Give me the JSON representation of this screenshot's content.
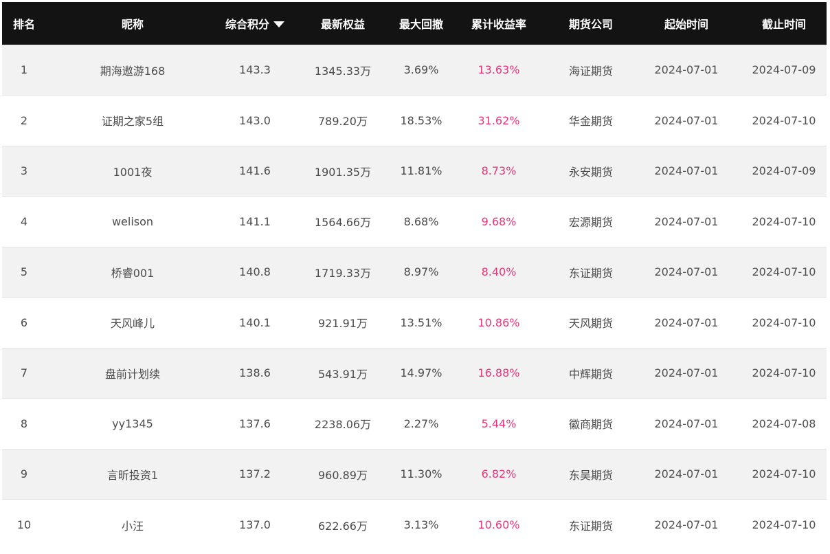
{
  "header": {
    "rank": "排名",
    "nickname": "昵称",
    "score": "综合积分",
    "equity": "最新权益",
    "drawdown": "最大回撤",
    "return": "累计收益率",
    "company": "期货公司",
    "start": "起始时间",
    "end": "截止时间"
  },
  "colors": {
    "header_bg": "#131313",
    "return_color": "#e8357a",
    "row_alt": "#f2f2f2"
  },
  "rows": [
    {
      "rank": "1",
      "nickname": "期海遨游168",
      "score": "143.3",
      "equity": "1345.33万",
      "drawdown": "3.69%",
      "return": "13.63%",
      "company": "海证期货",
      "start": "2024-07-01",
      "end": "2024-07-09"
    },
    {
      "rank": "2",
      "nickname": "证期之家5组",
      "score": "143.0",
      "equity": "789.20万",
      "drawdown": "18.53%",
      "return": "31.62%",
      "company": "华金期货",
      "start": "2024-07-01",
      "end": "2024-07-10"
    },
    {
      "rank": "3",
      "nickname": "1001夜",
      "score": "141.6",
      "equity": "1901.35万",
      "drawdown": "11.81%",
      "return": "8.73%",
      "company": "永安期货",
      "start": "2024-07-01",
      "end": "2024-07-09"
    },
    {
      "rank": "4",
      "nickname": "welison",
      "score": "141.1",
      "equity": "1564.66万",
      "drawdown": "8.68%",
      "return": "9.68%",
      "company": "宏源期货",
      "start": "2024-07-01",
      "end": "2024-07-10"
    },
    {
      "rank": "5",
      "nickname": "桥睿001",
      "score": "140.8",
      "equity": "1719.33万",
      "drawdown": "8.97%",
      "return": "8.40%",
      "company": "东证期货",
      "start": "2024-07-01",
      "end": "2024-07-10"
    },
    {
      "rank": "6",
      "nickname": "天风峰儿",
      "score": "140.1",
      "equity": "921.91万",
      "drawdown": "13.51%",
      "return": "10.86%",
      "company": "天风期货",
      "start": "2024-07-01",
      "end": "2024-07-10"
    },
    {
      "rank": "7",
      "nickname": "盘前计划续",
      "score": "138.6",
      "equity": "543.91万",
      "drawdown": "14.97%",
      "return": "16.88%",
      "company": "中辉期货",
      "start": "2024-07-01",
      "end": "2024-07-10"
    },
    {
      "rank": "8",
      "nickname": "yy1345",
      "score": "137.6",
      "equity": "2238.06万",
      "drawdown": "2.27%",
      "return": "5.44%",
      "company": "徽商期货",
      "start": "2024-07-01",
      "end": "2024-07-08"
    },
    {
      "rank": "9",
      "nickname": "言昕投资1",
      "score": "137.2",
      "equity": "960.89万",
      "drawdown": "11.30%",
      "return": "6.82%",
      "company": "东吴期货",
      "start": "2024-07-01",
      "end": "2024-07-10"
    },
    {
      "rank": "10",
      "nickname": "小汪",
      "score": "137.0",
      "equity": "622.66万",
      "drawdown": "3.13%",
      "return": "10.60%",
      "company": "东证期货",
      "start": "2024-07-01",
      "end": "2024-07-10"
    }
  ]
}
